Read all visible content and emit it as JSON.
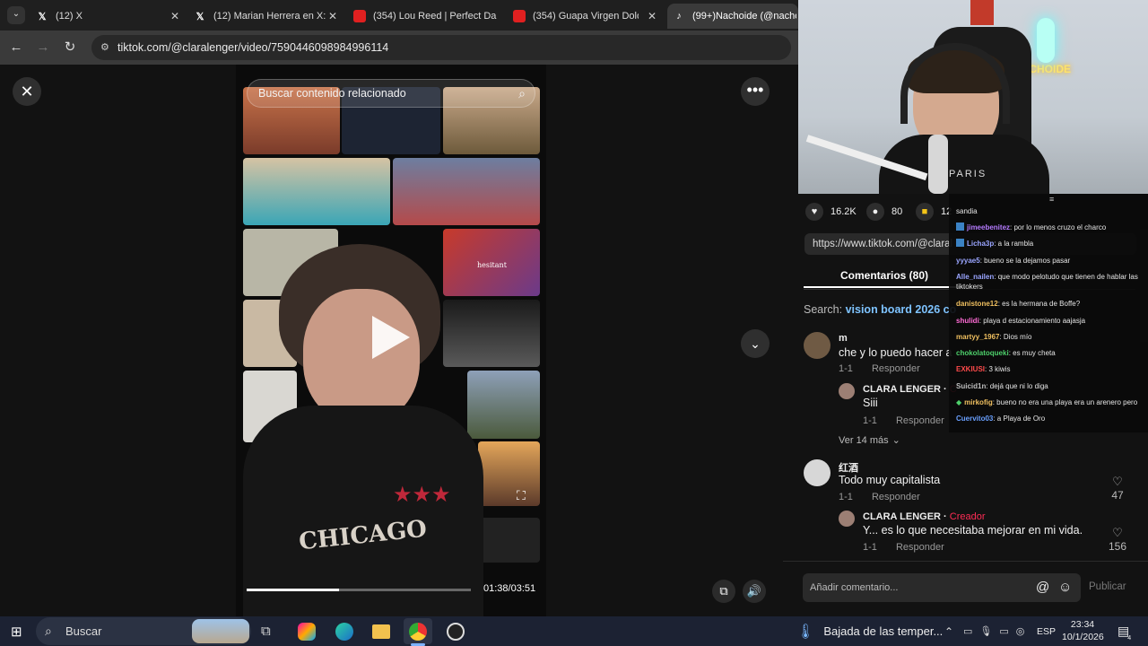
{
  "tabs": [
    {
      "label": "(12) X",
      "favicon": "x-logo-icon"
    },
    {
      "label": "(12) Marian Herrera en X: \"",
      "favicon": "x-logo-icon"
    },
    {
      "label": "(354) Lou Reed | Perfect Da",
      "favicon": "youtube-icon"
    },
    {
      "label": "(354) Guapa Virgen Dolore",
      "favicon": "youtube-icon"
    },
    {
      "label": "(99+)Nachoide (@nachoid",
      "favicon": "tiktok-icon"
    }
  ],
  "address": {
    "url": "tiktok.com/@claralenger/video/7590446098984996114"
  },
  "video": {
    "search_placeholder": "Buscar contenido relacionado",
    "overlay_text": "hesitant",
    "shirt_text": "CHICAGO",
    "progress_fraction": 0.41,
    "timecode": "01:38/03:51"
  },
  "stats": {
    "likes": "16.2K",
    "comments": "80",
    "saves": "12"
  },
  "share_link": "https://www.tiktok.com/@claral",
  "comments_tab": "Comentarios (80)",
  "search": {
    "prefix": "Search:",
    "query": "vision board 2026 co"
  },
  "comments": [
    {
      "user": "m",
      "text": "che y lo puedo hacer a",
      "meta_count": "1-1",
      "reply": "Responder"
    },
    {
      "user": "CLARA LENGER",
      "sep": "·",
      "creator": "C",
      "text": "Siii",
      "meta_count": "1-1",
      "reply": "Responder"
    },
    {
      "more": "Ver 14 más"
    },
    {
      "user": "红酒",
      "text": "Todo muy capitalista",
      "meta_count": "1-1",
      "reply": "Responder",
      "likes": "47"
    },
    {
      "user": "CLARA LENGER",
      "sep": "·",
      "creator": "Creador",
      "text": "Y... es lo que necesitaba mejorar en mi vida.",
      "meta_count": "1-1",
      "reply": "Responder",
      "likes": "156"
    }
  ],
  "add_comment": {
    "placeholder": "Añadir comentario...",
    "publish": "Publicar"
  },
  "chat": [
    {
      "user": "",
      "text": "sandia",
      "color": "#e6e6e6"
    },
    {
      "user": "jimeebenitez",
      "text": ": por lo menos cruzo el charco",
      "color": "#b57bff"
    },
    {
      "user": "Licha3p",
      "text": ": a la rambla",
      "color": "#9aa5ff"
    },
    {
      "user": "yyyae5",
      "text": ": bueno se la dejamos pasar",
      "color": "#9aa5ff"
    },
    {
      "user": "Alle_nailen",
      "text": ": que modo pelotudo que tienen de hablar las tiktokers",
      "color": "#9aa5ff"
    },
    {
      "user": "danistone12",
      "text": ": es la hermana de Boffe?",
      "color": "#f0c060"
    },
    {
      "user": "shulidi",
      "text": ": playa d estacionamiento aajasja",
      "color": "#ff6bd5"
    },
    {
      "user": "martyy_1967",
      "text": ": Dios mío",
      "color": "#f0c060"
    },
    {
      "user": "chokolatoqueki",
      "text": ": es muy cheta",
      "color": "#4ed06b"
    },
    {
      "user": "EXKIUSI",
      "text": ": 3 kiwis",
      "color": "#ff4b4b"
    },
    {
      "user": "Suicid1n",
      "text": ": dejá que ni lo diga",
      "color": "#bfbfbf"
    },
    {
      "user": "mirkofig",
      "text": ": bueno no era una playa era un arenero pero",
      "color": "#f0c060"
    },
    {
      "user": "Cuervito03",
      "text": ": a Playa de Oro",
      "color": "#6aa0ff"
    }
  ],
  "webcam": {
    "sign": "NACHOIDE",
    "shirt": "PARIS"
  },
  "taskbar": {
    "search_label": "Buscar",
    "weather": "Bajada de las temper...",
    "lang": "ESP",
    "time": "23:34",
    "date": "10/1/2026",
    "notif_count": "4"
  }
}
